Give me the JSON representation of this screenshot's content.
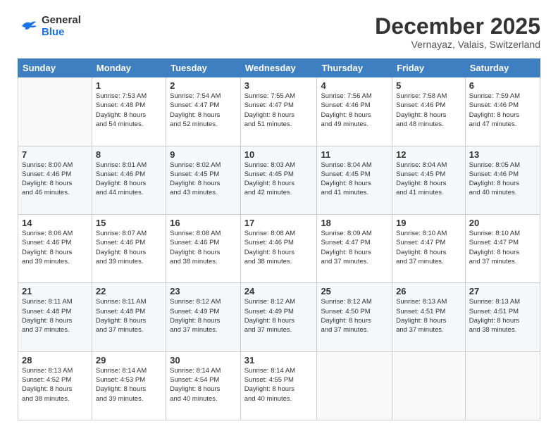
{
  "header": {
    "logo": {
      "line1": "General",
      "line2": "Blue"
    },
    "title": "December 2025",
    "subtitle": "Vernayaz, Valais, Switzerland"
  },
  "weekdays": [
    "Sunday",
    "Monday",
    "Tuesday",
    "Wednesday",
    "Thursday",
    "Friday",
    "Saturday"
  ],
  "weeks": [
    [
      {
        "day": "",
        "info": ""
      },
      {
        "day": "1",
        "info": "Sunrise: 7:53 AM\nSunset: 4:48 PM\nDaylight: 8 hours\nand 54 minutes."
      },
      {
        "day": "2",
        "info": "Sunrise: 7:54 AM\nSunset: 4:47 PM\nDaylight: 8 hours\nand 52 minutes."
      },
      {
        "day": "3",
        "info": "Sunrise: 7:55 AM\nSunset: 4:47 PM\nDaylight: 8 hours\nand 51 minutes."
      },
      {
        "day": "4",
        "info": "Sunrise: 7:56 AM\nSunset: 4:46 PM\nDaylight: 8 hours\nand 49 minutes."
      },
      {
        "day": "5",
        "info": "Sunrise: 7:58 AM\nSunset: 4:46 PM\nDaylight: 8 hours\nand 48 minutes."
      },
      {
        "day": "6",
        "info": "Sunrise: 7:59 AM\nSunset: 4:46 PM\nDaylight: 8 hours\nand 47 minutes."
      }
    ],
    [
      {
        "day": "7",
        "info": "Sunrise: 8:00 AM\nSunset: 4:46 PM\nDaylight: 8 hours\nand 46 minutes."
      },
      {
        "day": "8",
        "info": "Sunrise: 8:01 AM\nSunset: 4:46 PM\nDaylight: 8 hours\nand 44 minutes."
      },
      {
        "day": "9",
        "info": "Sunrise: 8:02 AM\nSunset: 4:45 PM\nDaylight: 8 hours\nand 43 minutes."
      },
      {
        "day": "10",
        "info": "Sunrise: 8:03 AM\nSunset: 4:45 PM\nDaylight: 8 hours\nand 42 minutes."
      },
      {
        "day": "11",
        "info": "Sunrise: 8:04 AM\nSunset: 4:45 PM\nDaylight: 8 hours\nand 41 minutes."
      },
      {
        "day": "12",
        "info": "Sunrise: 8:04 AM\nSunset: 4:45 PM\nDaylight: 8 hours\nand 41 minutes."
      },
      {
        "day": "13",
        "info": "Sunrise: 8:05 AM\nSunset: 4:46 PM\nDaylight: 8 hours\nand 40 minutes."
      }
    ],
    [
      {
        "day": "14",
        "info": "Sunrise: 8:06 AM\nSunset: 4:46 PM\nDaylight: 8 hours\nand 39 minutes."
      },
      {
        "day": "15",
        "info": "Sunrise: 8:07 AM\nSunset: 4:46 PM\nDaylight: 8 hours\nand 39 minutes."
      },
      {
        "day": "16",
        "info": "Sunrise: 8:08 AM\nSunset: 4:46 PM\nDaylight: 8 hours\nand 38 minutes."
      },
      {
        "day": "17",
        "info": "Sunrise: 8:08 AM\nSunset: 4:46 PM\nDaylight: 8 hours\nand 38 minutes."
      },
      {
        "day": "18",
        "info": "Sunrise: 8:09 AM\nSunset: 4:47 PM\nDaylight: 8 hours\nand 37 minutes."
      },
      {
        "day": "19",
        "info": "Sunrise: 8:10 AM\nSunset: 4:47 PM\nDaylight: 8 hours\nand 37 minutes."
      },
      {
        "day": "20",
        "info": "Sunrise: 8:10 AM\nSunset: 4:47 PM\nDaylight: 8 hours\nand 37 minutes."
      }
    ],
    [
      {
        "day": "21",
        "info": "Sunrise: 8:11 AM\nSunset: 4:48 PM\nDaylight: 8 hours\nand 37 minutes."
      },
      {
        "day": "22",
        "info": "Sunrise: 8:11 AM\nSunset: 4:48 PM\nDaylight: 8 hours\nand 37 minutes."
      },
      {
        "day": "23",
        "info": "Sunrise: 8:12 AM\nSunset: 4:49 PM\nDaylight: 8 hours\nand 37 minutes."
      },
      {
        "day": "24",
        "info": "Sunrise: 8:12 AM\nSunset: 4:49 PM\nDaylight: 8 hours\nand 37 minutes."
      },
      {
        "day": "25",
        "info": "Sunrise: 8:12 AM\nSunset: 4:50 PM\nDaylight: 8 hours\nand 37 minutes."
      },
      {
        "day": "26",
        "info": "Sunrise: 8:13 AM\nSunset: 4:51 PM\nDaylight: 8 hours\nand 37 minutes."
      },
      {
        "day": "27",
        "info": "Sunrise: 8:13 AM\nSunset: 4:51 PM\nDaylight: 8 hours\nand 38 minutes."
      }
    ],
    [
      {
        "day": "28",
        "info": "Sunrise: 8:13 AM\nSunset: 4:52 PM\nDaylight: 8 hours\nand 38 minutes."
      },
      {
        "day": "29",
        "info": "Sunrise: 8:14 AM\nSunset: 4:53 PM\nDaylight: 8 hours\nand 39 minutes."
      },
      {
        "day": "30",
        "info": "Sunrise: 8:14 AM\nSunset: 4:54 PM\nDaylight: 8 hours\nand 40 minutes."
      },
      {
        "day": "31",
        "info": "Sunrise: 8:14 AM\nSunset: 4:55 PM\nDaylight: 8 hours\nand 40 minutes."
      },
      {
        "day": "",
        "info": ""
      },
      {
        "day": "",
        "info": ""
      },
      {
        "day": "",
        "info": ""
      }
    ]
  ]
}
